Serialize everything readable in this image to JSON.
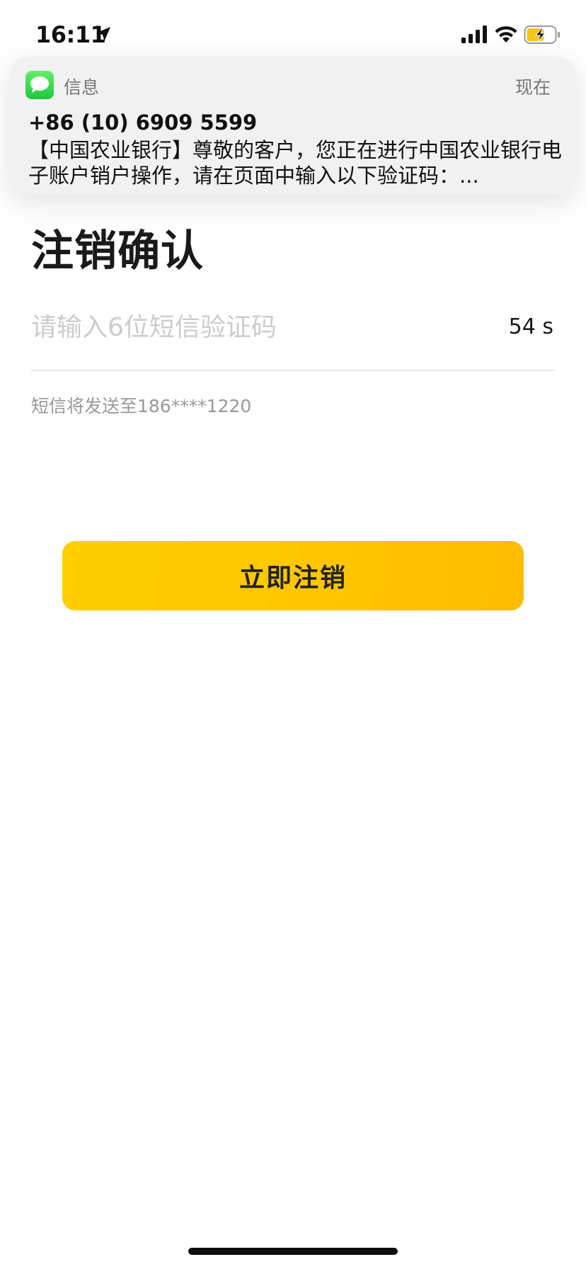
{
  "status_bar": {
    "time": "16:11",
    "icons": [
      "location-arrow-icon",
      "cellular-signal-icon",
      "wifi-icon",
      "battery-charging-icon"
    ],
    "battery_color": "#f5c518"
  },
  "notification": {
    "app_icon": "messages-icon",
    "app_name": "信息",
    "time": "现在",
    "sender": "+86 (10) 6909 5599",
    "body": "【中国农业银行】尊敬的客户，您正在进行中国农业银行电子账户销户操作，请在页面中输入以下验证码：..."
  },
  "page": {
    "title": "注销确认",
    "code_input": {
      "placeholder": "请输入6位短信验证码",
      "value": ""
    },
    "countdown": "54 s",
    "sms_hint": "短信将发送至186****1220",
    "submit_label": "立即注销"
  },
  "colors": {
    "accent": "#ffc500",
    "placeholder": "#cccccc",
    "hint": "#999999"
  }
}
